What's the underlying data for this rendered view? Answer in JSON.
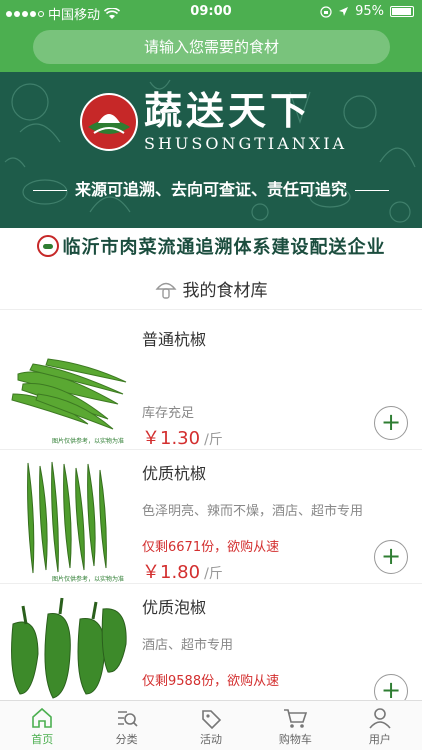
{
  "status_bar": {
    "carrier": "中国移动",
    "time": "09:00",
    "battery": "95%"
  },
  "search": {
    "placeholder": "请输入您需要的食材"
  },
  "banner": {
    "brand_cn": "蔬送天下",
    "brand_en": "SHUSONGTIANXIA",
    "slogan": "来源可追溯、去向可查证、责任可追究"
  },
  "company_line": "临沂市肉菜流通追溯体系建设配送企业",
  "section": {
    "title": "我的食材库"
  },
  "image_note": "图片仅供参考，以实物为准",
  "products": [
    {
      "name": "普通杭椒",
      "desc": "",
      "stock": "库存充足",
      "price": "￥1.30",
      "unit": "/斤",
      "add": "+"
    },
    {
      "name": "优质杭椒",
      "desc": "色泽明亮、辣而不燥，酒店、超市专用",
      "stock": "仅剩6671份，欲购从速",
      "price": "￥1.80",
      "unit": "/斤",
      "add": "+"
    },
    {
      "name": "优质泡椒",
      "desc": "酒店、超市专用",
      "stock": "仅剩9588份，欲购从速",
      "price": "",
      "unit": "",
      "add": "+"
    }
  ],
  "tabs": [
    {
      "label": "首页",
      "icon": "home-icon",
      "active": true
    },
    {
      "label": "分类",
      "icon": "category-search-icon",
      "active": false
    },
    {
      "label": "活动",
      "icon": "tag-icon",
      "active": false
    },
    {
      "label": "购物车",
      "icon": "cart-icon",
      "active": false
    },
    {
      "label": "用户",
      "icon": "user-icon",
      "active": false
    }
  ],
  "colors": {
    "primary": "#4caf50",
    "banner": "#1e5c4a",
    "price": "#d32f2f"
  }
}
